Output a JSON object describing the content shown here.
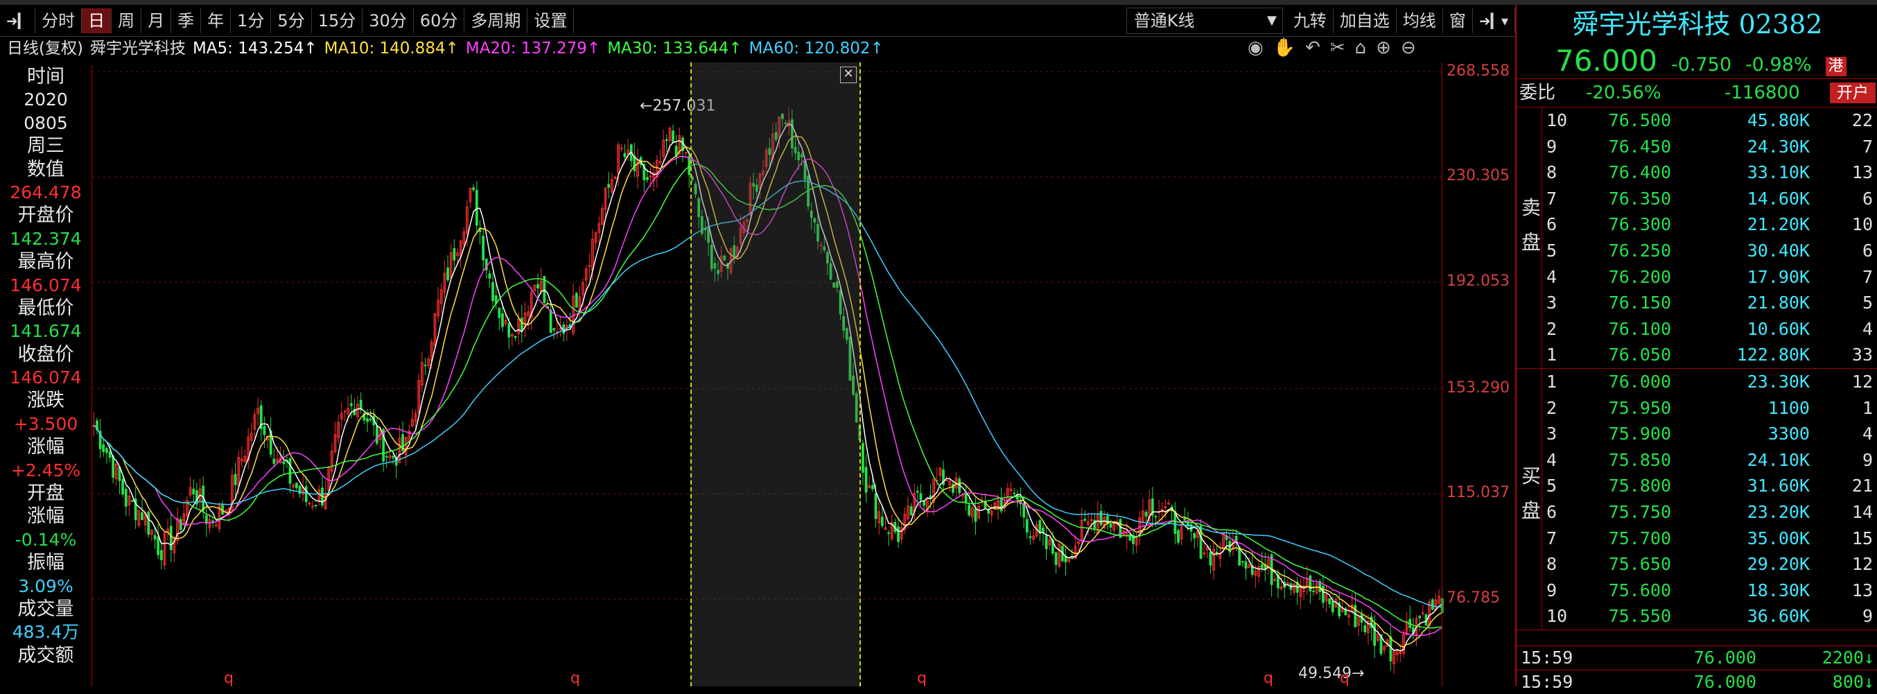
{
  "toolbar": {
    "items": [
      "分时",
      "日",
      "周",
      "月",
      "季",
      "年",
      "1分",
      "5分",
      "15分",
      "30分",
      "60分",
      "多周期",
      "设置"
    ],
    "active_index": 1,
    "kline_type": "普通K线",
    "right_items": [
      "九转",
      "加自选",
      "均线",
      "窗"
    ]
  },
  "ma_line": {
    "prefix": "日线(复权)",
    "name": "舜宇光学科技",
    "ma5": "MA5: 143.254↑",
    "ma10": "MA10: 140.884↑",
    "ma20": "MA20: 137.279↑",
    "ma30": "MA30: 133.644↑",
    "ma60": "MA60: 120.802↑"
  },
  "info_panel": [
    {
      "label": "时间",
      "value": "2020"
    },
    {
      "label": "",
      "value": "0805"
    },
    {
      "label": "周三",
      "value": ""
    },
    {
      "label": "数值",
      "value": "264.478"
    },
    {
      "label": "开盘价",
      "value": "142.374"
    },
    {
      "label": "最高价",
      "value": "146.074"
    },
    {
      "label": "最低价",
      "value": "141.674"
    },
    {
      "label": "收盘价",
      "value": "146.074"
    },
    {
      "label": "涨跌",
      "value": "+3.500"
    },
    {
      "label": "涨幅",
      "value": "+2.45%"
    },
    {
      "label": "开盘",
      "value": ""
    },
    {
      "label": "涨幅",
      "value": "-0.14%"
    },
    {
      "label": "振幅",
      "value": "3.09%"
    },
    {
      "label": "成交量",
      "value": "483.4万"
    },
    {
      "label": "成交额",
      "value": ""
    }
  ],
  "colors": {
    "up": "#ff3030",
    "down": "#27e04a",
    "ma5": "#ffffff",
    "ma10": "#ffe040",
    "ma20": "#ff40ff",
    "ma30": "#40ff40",
    "ma60": "#40d0ff",
    "accent": "#c02020"
  },
  "axis": {
    "labels": [
      "268.558",
      "230.305",
      "192.053",
      "153.290",
      "115.037",
      "76.785"
    ],
    "values": [
      268.558,
      230.305,
      192.053,
      153.29,
      115.037,
      76.785
    ]
  },
  "chart_marks": {
    "high_label": "257.031",
    "low_label": "49.549",
    "bottom_markers": [
      "q",
      "q",
      "q",
      "q",
      "q"
    ]
  },
  "chart_data": {
    "type": "candlestick",
    "ylim": [
      45,
      272
    ],
    "close_path": [
      140,
      128,
      112,
      108,
      95,
      100,
      118,
      105,
      110,
      128,
      145,
      130,
      120,
      112,
      115,
      140,
      150,
      138,
      128,
      132,
      160,
      185,
      205,
      225,
      195,
      175,
      178,
      195,
      170,
      180,
      200,
      220,
      240,
      232,
      228,
      245,
      238,
      210,
      195,
      205,
      225,
      240,
      252,
      235,
      210,
      195,
      160,
      118,
      105,
      100,
      112,
      118,
      122,
      110,
      108,
      112,
      115,
      102,
      95,
      92,
      100,
      108,
      105,
      98,
      112,
      110,
      102,
      98,
      93,
      98,
      92,
      88,
      85,
      84,
      80,
      76,
      72,
      70,
      62,
      58,
      68,
      72,
      76
    ]
  },
  "side": {
    "title": "舜宇光学科技 02382",
    "price": "76.000",
    "change": "-0.750",
    "pct": "-0.98%",
    "tag": "港",
    "weibi_label": "委比",
    "weibi_pct": "-20.56%",
    "weibi_val": "-116800",
    "open_btn": "开户",
    "sell_label": [
      "卖",
      "盘"
    ],
    "buy_label": [
      "买",
      "盘"
    ],
    "sell": [
      {
        "lvl": "10",
        "price": "76.500",
        "vol": "45.80K",
        "cnt": "22"
      },
      {
        "lvl": "9",
        "price": "76.450",
        "vol": "24.30K",
        "cnt": "7"
      },
      {
        "lvl": "8",
        "price": "76.400",
        "vol": "33.10K",
        "cnt": "13"
      },
      {
        "lvl": "7",
        "price": "76.350",
        "vol": "14.60K",
        "cnt": "6"
      },
      {
        "lvl": "6",
        "price": "76.300",
        "vol": "21.20K",
        "cnt": "10"
      },
      {
        "lvl": "5",
        "price": "76.250",
        "vol": "30.40K",
        "cnt": "6"
      },
      {
        "lvl": "4",
        "price": "76.200",
        "vol": "17.90K",
        "cnt": "7"
      },
      {
        "lvl": "3",
        "price": "76.150",
        "vol": "21.80K",
        "cnt": "5"
      },
      {
        "lvl": "2",
        "price": "76.100",
        "vol": "10.60K",
        "cnt": "4"
      },
      {
        "lvl": "1",
        "price": "76.050",
        "vol": "122.80K",
        "cnt": "33"
      }
    ],
    "buy": [
      {
        "lvl": "1",
        "price": "76.000",
        "vol": "23.30K",
        "cnt": "12"
      },
      {
        "lvl": "2",
        "price": "75.950",
        "vol": "1100",
        "cnt": "1"
      },
      {
        "lvl": "3",
        "price": "75.900",
        "vol": "3300",
        "cnt": "4"
      },
      {
        "lvl": "4",
        "price": "75.850",
        "vol": "24.10K",
        "cnt": "9"
      },
      {
        "lvl": "5",
        "price": "75.800",
        "vol": "31.60K",
        "cnt": "21"
      },
      {
        "lvl": "6",
        "price": "75.750",
        "vol": "23.20K",
        "cnt": "14"
      },
      {
        "lvl": "7",
        "price": "75.700",
        "vol": "35.00K",
        "cnt": "15"
      },
      {
        "lvl": "8",
        "price": "75.650",
        "vol": "29.20K",
        "cnt": "12"
      },
      {
        "lvl": "9",
        "price": "75.600",
        "vol": "18.30K",
        "cnt": "13"
      },
      {
        "lvl": "10",
        "price": "75.550",
        "vol": "36.60K",
        "cnt": "9"
      }
    ],
    "ticks": [
      {
        "time": "15:59",
        "price": "76.000",
        "vol": "2200↓"
      },
      {
        "time": "15:59",
        "price": "76.000",
        "vol": "800↓"
      }
    ]
  }
}
